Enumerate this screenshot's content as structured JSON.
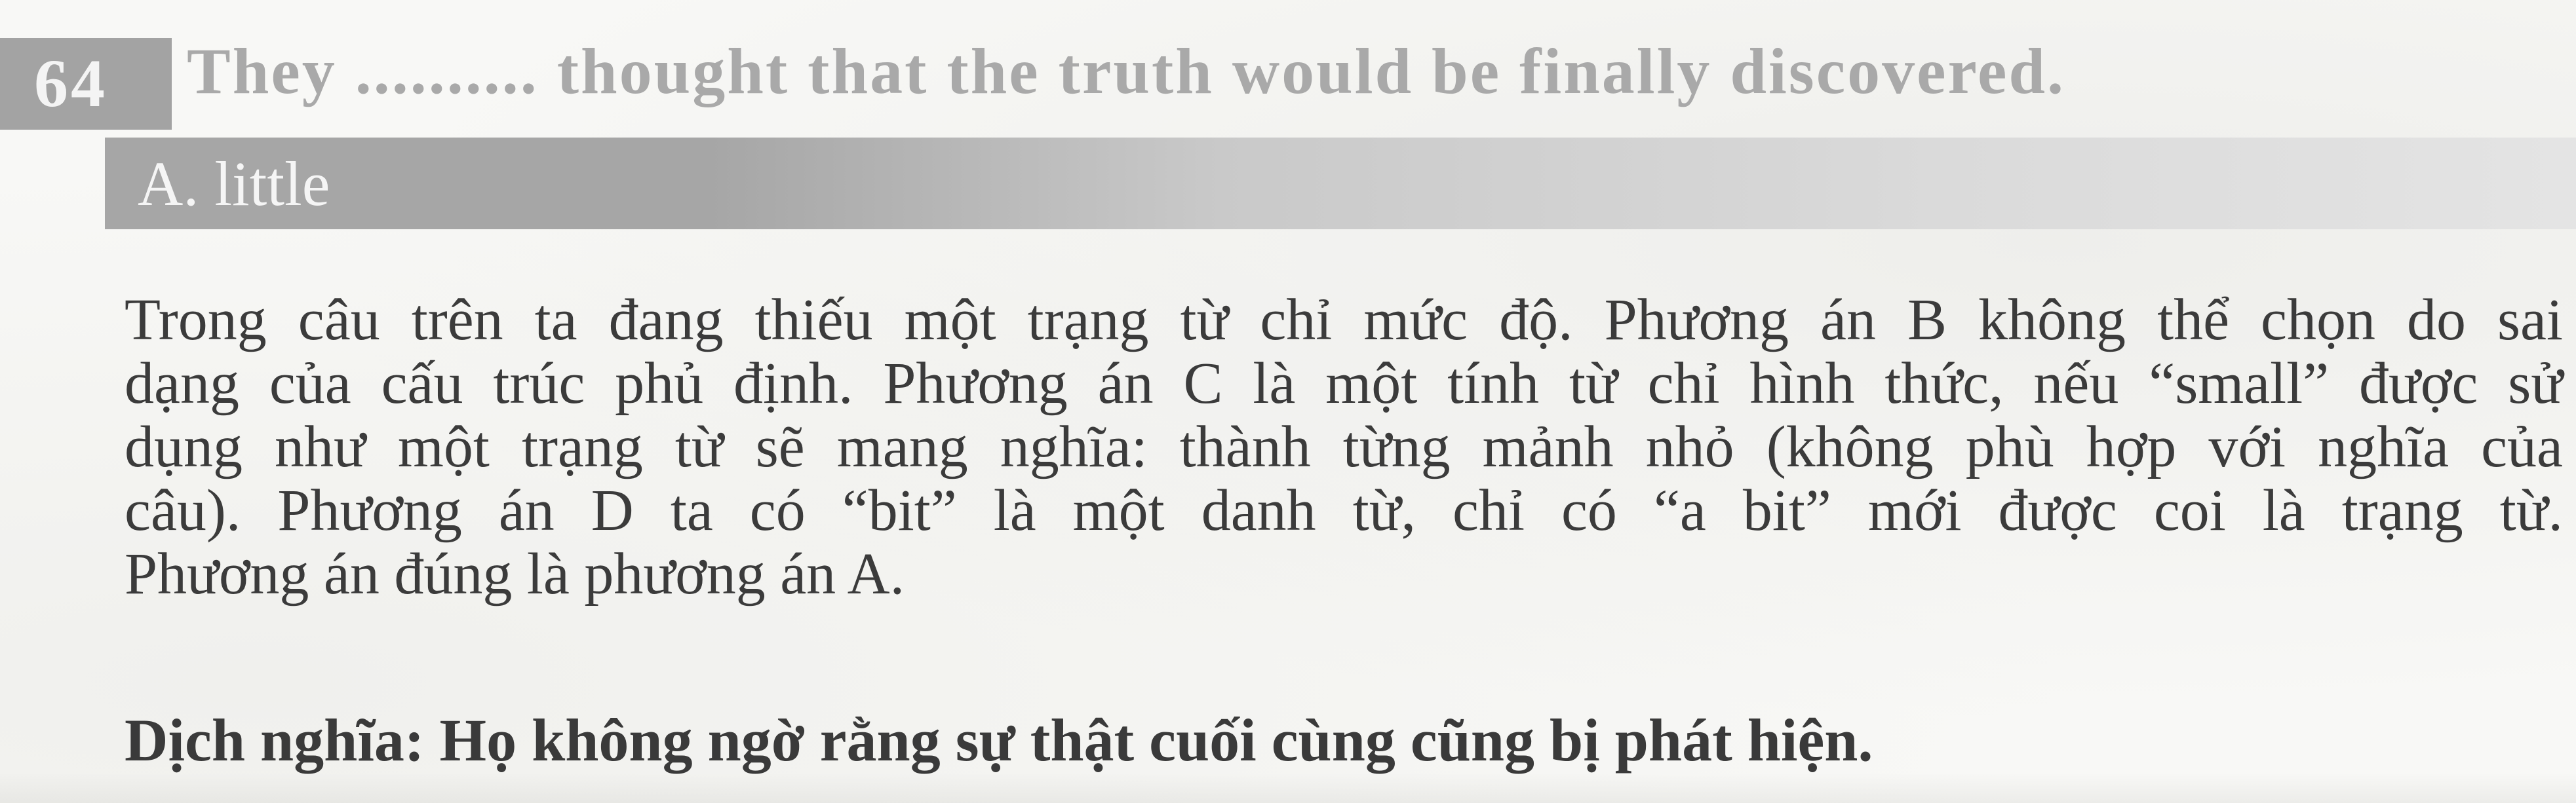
{
  "question": {
    "number": "64",
    "text": "They .......... thought that the truth would be finally discovered."
  },
  "answer": {
    "label": "A. little"
  },
  "explanation": {
    "lines": [
      "Trong câu trên ta đang thiếu một trạng từ chỉ mức độ. Phương án B không thể chọn do sai",
      "dạng của cấu trúc phủ định. Phương án C là một tính từ chỉ hình thức, nếu “small” được sử",
      "dụng như một trạng từ sẽ mang nghĩa: thành từng mảnh nhỏ (không phù hợp với nghĩa của",
      "câu). Phương án D ta có “bit” là một danh từ, chỉ có “a bit” mới được coi là trạng từ.",
      "Phương án đúng là phương án A."
    ]
  },
  "translation": {
    "text": "Dịch nghĩa: Họ không ngờ rằng sự thật cuối cùng cũng bị phát hiện."
  },
  "colors": {
    "header_gray": "#a3a3a3",
    "question_text": "#a9a9a9",
    "body_text": "#3b3b3b",
    "page_bg": "#f8f8f6"
  }
}
